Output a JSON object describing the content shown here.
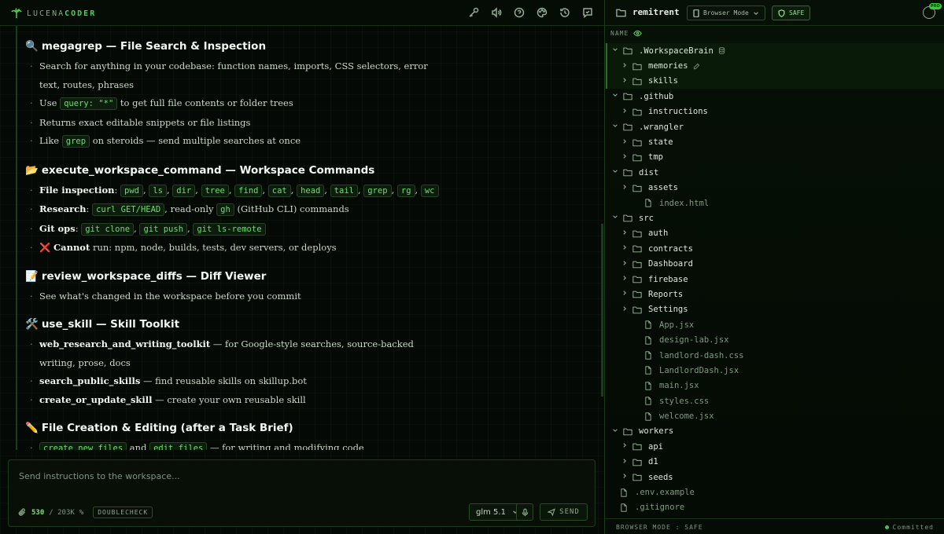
{
  "app": {
    "logo_prefix": "LUCENA",
    "logo_suffix": "CODER"
  },
  "toolbar_icons": [
    "key-icon",
    "speaker-icon",
    "help-icon",
    "palette-icon",
    "history-icon",
    "chat-icon"
  ],
  "content": {
    "sections": [
      {
        "emoji": "🔍",
        "title": "megagrep — File Search & Inspection",
        "bullets": [
          {
            "parts": [
              {
                "t": "text",
                "v": "Search for anything in your codebase: function names, imports, CSS selectors, error text, routes, phrases"
              }
            ]
          },
          {
            "parts": [
              {
                "t": "text",
                "v": "Use "
              },
              {
                "t": "code",
                "v": "query: \"*\""
              },
              {
                "t": "text",
                "v": " to get full file contents or folder trees"
              }
            ]
          },
          {
            "parts": [
              {
                "t": "text",
                "v": "Returns exact editable snippets or file listings"
              }
            ]
          },
          {
            "parts": [
              {
                "t": "text",
                "v": "Like "
              },
              {
                "t": "code",
                "v": "grep"
              },
              {
                "t": "text",
                "v": " on steroids — send multiple searches at once"
              }
            ]
          }
        ]
      },
      {
        "emoji": "📂",
        "title": "execute_workspace_command — Workspace Commands",
        "bullets": [
          {
            "parts": [
              {
                "t": "strong",
                "v": "File inspection"
              },
              {
                "t": "text",
                "v": ": "
              },
              {
                "t": "code",
                "v": "pwd"
              },
              {
                "t": "text",
                "v": ", "
              },
              {
                "t": "code",
                "v": "ls"
              },
              {
                "t": "text",
                "v": ", "
              },
              {
                "t": "code",
                "v": "dir"
              },
              {
                "t": "text",
                "v": ", "
              },
              {
                "t": "code",
                "v": "tree"
              },
              {
                "t": "text",
                "v": ", "
              },
              {
                "t": "code",
                "v": "find"
              },
              {
                "t": "text",
                "v": ", "
              },
              {
                "t": "code",
                "v": "cat"
              },
              {
                "t": "text",
                "v": ", "
              },
              {
                "t": "code",
                "v": "head"
              },
              {
                "t": "text",
                "v": ", "
              },
              {
                "t": "code",
                "v": "tail"
              },
              {
                "t": "text",
                "v": ", "
              },
              {
                "t": "code",
                "v": "grep"
              },
              {
                "t": "text",
                "v": ", "
              },
              {
                "t": "code",
                "v": "rg"
              },
              {
                "t": "text",
                "v": ", "
              },
              {
                "t": "code",
                "v": "wc"
              }
            ]
          },
          {
            "parts": [
              {
                "t": "strong",
                "v": "Research"
              },
              {
                "t": "text",
                "v": ": "
              },
              {
                "t": "code",
                "v": "curl GET/HEAD"
              },
              {
                "t": "text",
                "v": ", read-only "
              },
              {
                "t": "code",
                "v": "gh"
              },
              {
                "t": "text",
                "v": " (GitHub CLI) commands"
              }
            ]
          },
          {
            "parts": [
              {
                "t": "strong",
                "v": "Git ops"
              },
              {
                "t": "text",
                "v": ": "
              },
              {
                "t": "code",
                "v": "git clone"
              },
              {
                "t": "text",
                "v": ", "
              },
              {
                "t": "code",
                "v": "git push"
              },
              {
                "t": "text",
                "v": ", "
              },
              {
                "t": "code",
                "v": "git ls-remote"
              }
            ]
          },
          {
            "parts": [
              {
                "t": "x",
                "v": "❌"
              },
              {
                "t": "text",
                "v": " "
              },
              {
                "t": "strong",
                "v": "Cannot"
              },
              {
                "t": "text",
                "v": " run: npm, node, builds, tests, dev servers, or deploys"
              }
            ]
          }
        ]
      },
      {
        "emoji": "📝",
        "title": "review_workspace_diffs — Diff Viewer",
        "bullets": [
          {
            "parts": [
              {
                "t": "text",
                "v": "See what's changed in the workspace before you commit"
              }
            ]
          }
        ]
      },
      {
        "emoji": "🛠️",
        "title": "use_skill — Skill Toolkit",
        "bullets": [
          {
            "parts": [
              {
                "t": "strong",
                "v": "web_research_and_writing_toolkit"
              },
              {
                "t": "text",
                "v": " — for Google-style searches, source-backed writing, prose, docs"
              }
            ]
          },
          {
            "parts": [
              {
                "t": "strong",
                "v": "search_public_skills"
              },
              {
                "t": "text",
                "v": " — find reusable skills on skillup.bot"
              }
            ]
          },
          {
            "parts": [
              {
                "t": "strong",
                "v": "create_or_update_skill"
              },
              {
                "t": "text",
                "v": " — create your own reusable skill"
              }
            ]
          }
        ]
      },
      {
        "emoji": "✏️",
        "title": "File Creation & Editing (after a Task Brief)",
        "bullets": [
          {
            "parts": [
              {
                "t": "code",
                "v": "create_new_files"
              },
              {
                "t": "text",
                "v": " and "
              },
              {
                "t": "code",
                "v": "edit_files"
              },
              {
                "t": "text",
                "v": " — for writing and modifying code"
              }
            ]
          }
        ]
      }
    ]
  },
  "composer": {
    "placeholder": "Send instructions to the workspace...",
    "count": "530",
    "limit": "/ 203K",
    "percent": "%",
    "doublecheck": "DOUBLECHECK",
    "model": "glm 5.1",
    "send": "SEND"
  },
  "explorer": {
    "folder": "remitrent",
    "browser_mode": "Browser Mode",
    "safe": "SAFE",
    "pro_badge": "PRO",
    "name_header": "NAME",
    "tree": [
      {
        "depth": 0,
        "kind": "folder",
        "open": true,
        "name": ".WorkspaceBrain",
        "extra": "db-icon",
        "sel": true
      },
      {
        "depth": 1,
        "kind": "folder",
        "open": false,
        "name": "memories",
        "extra": "edit-icon",
        "sel": true
      },
      {
        "depth": 1,
        "kind": "folder",
        "open": false,
        "name": "skills",
        "sel": true
      },
      {
        "depth": 0,
        "kind": "folder",
        "open": true,
        "name": ".github"
      },
      {
        "depth": 1,
        "kind": "folder",
        "open": false,
        "name": "instructions"
      },
      {
        "depth": 0,
        "kind": "folder",
        "open": true,
        "name": ".wrangler"
      },
      {
        "depth": 1,
        "kind": "folder",
        "open": false,
        "name": "state"
      },
      {
        "depth": 1,
        "kind": "folder",
        "open": false,
        "name": "tmp"
      },
      {
        "depth": 0,
        "kind": "folder",
        "open": true,
        "name": "dist"
      },
      {
        "depth": 1,
        "kind": "folder",
        "open": false,
        "name": "assets"
      },
      {
        "depth": 1,
        "kind": "file",
        "name": "index.html"
      },
      {
        "depth": 0,
        "kind": "folder",
        "open": true,
        "name": "src"
      },
      {
        "depth": 1,
        "kind": "folder",
        "open": false,
        "name": "auth"
      },
      {
        "depth": 1,
        "kind": "folder",
        "open": false,
        "name": "contracts"
      },
      {
        "depth": 1,
        "kind": "folder",
        "open": false,
        "name": "Dashboard"
      },
      {
        "depth": 1,
        "kind": "folder",
        "open": false,
        "name": "firebase"
      },
      {
        "depth": 1,
        "kind": "folder",
        "open": false,
        "name": "Reports"
      },
      {
        "depth": 1,
        "kind": "folder",
        "open": false,
        "name": "Settings"
      },
      {
        "depth": 1,
        "kind": "file",
        "name": "App.jsx"
      },
      {
        "depth": 1,
        "kind": "file",
        "name": "design-lab.jsx"
      },
      {
        "depth": 1,
        "kind": "file",
        "name": "landlord-dash.css"
      },
      {
        "depth": 1,
        "kind": "file",
        "name": "LandlordDash.jsx"
      },
      {
        "depth": 1,
        "kind": "file",
        "name": "main.jsx"
      },
      {
        "depth": 1,
        "kind": "file",
        "name": "styles.css"
      },
      {
        "depth": 1,
        "kind": "file",
        "name": "welcome.jsx"
      },
      {
        "depth": 0,
        "kind": "folder",
        "open": true,
        "name": "workers"
      },
      {
        "depth": 1,
        "kind": "folder",
        "open": false,
        "name": "api"
      },
      {
        "depth": 1,
        "kind": "folder",
        "open": false,
        "name": "d1"
      },
      {
        "depth": 1,
        "kind": "folder",
        "open": false,
        "name": "seeds"
      },
      {
        "depth": 0,
        "kind": "file",
        "name": ".env.example"
      },
      {
        "depth": 0,
        "kind": "file",
        "name": ".gitignore"
      }
    ],
    "status_left": "BROWSER MODE : SAFE",
    "status_right": "Committed"
  }
}
